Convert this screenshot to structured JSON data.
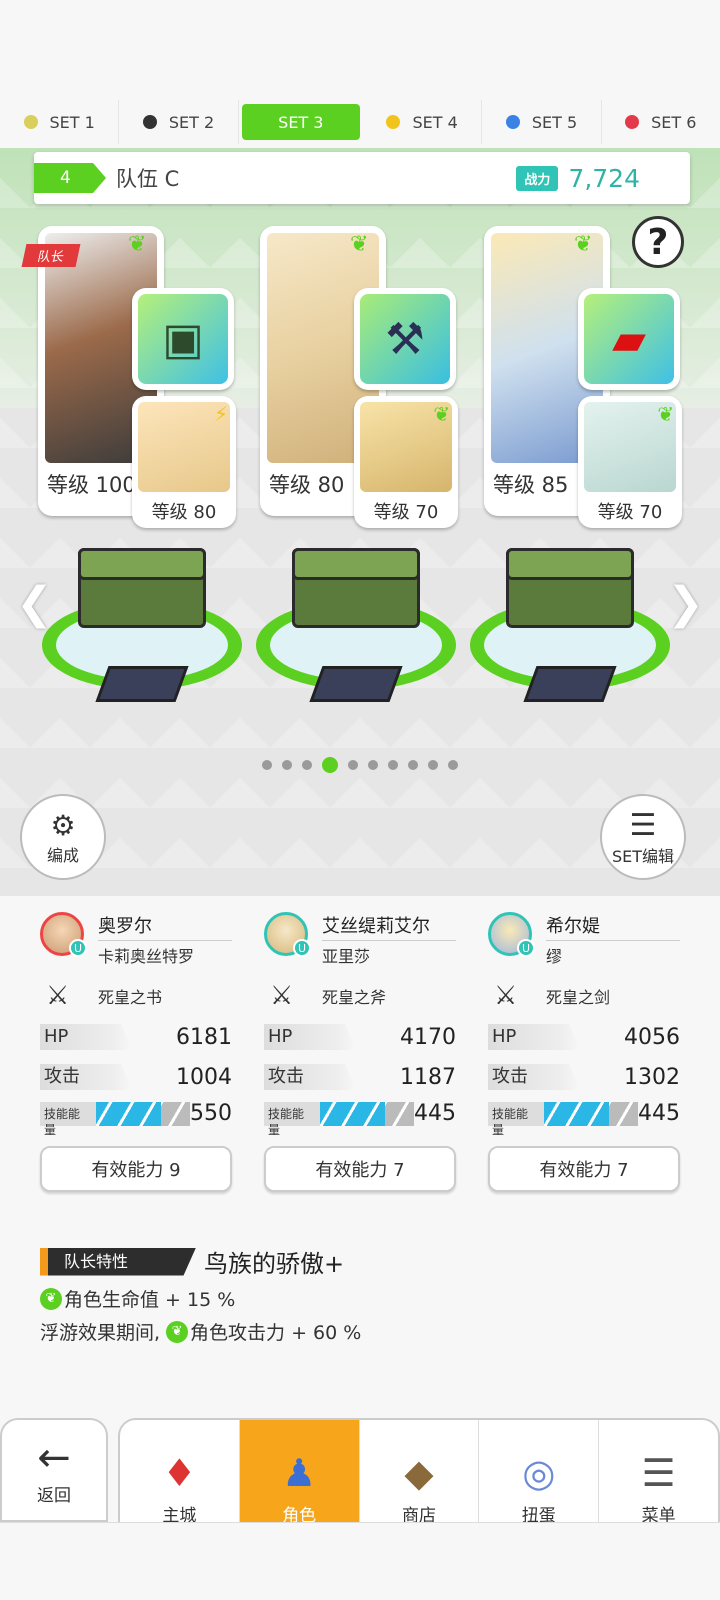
{
  "set_tabs": [
    {
      "label": "SET 1",
      "color": "#d9cf5a"
    },
    {
      "label": "SET 2",
      "color": "#333333"
    },
    {
      "label": "SET 3",
      "color": "#5bd020"
    },
    {
      "label": "SET 4",
      "color": "#f2c41b"
    },
    {
      "label": "SET 5",
      "color": "#3b82e6"
    },
    {
      "label": "SET 6",
      "color": "#e23a4a"
    }
  ],
  "team": {
    "number": "4",
    "name": "队伍 C",
    "power_label": "战力",
    "power_value": "7,724"
  },
  "help": "?",
  "slots": [
    {
      "leader_tag": "队长",
      "main_level": "等级 100",
      "sub_level": "等级 80"
    },
    {
      "main_level": "等级 80",
      "sub_level": "等级 70"
    },
    {
      "main_level": "等级 85",
      "sub_level": "等级 70"
    }
  ],
  "buttons": {
    "formation": "编成",
    "set_edit": "SET编辑"
  },
  "members": [
    {
      "name": "奥罗尔",
      "sub": "卡莉奥丝特罗",
      "weapon": "死皇之书",
      "hp_label": "HP",
      "hp": "6181",
      "atk_label": "攻击",
      "atk": "1004",
      "energy_label": "技能能量",
      "energy": "550",
      "ability": "有效能力 9"
    },
    {
      "name": "艾丝缇莉艾尔",
      "sub": "亚里莎",
      "weapon": "死皇之斧",
      "hp_label": "HP",
      "hp": "4170",
      "atk_label": "攻击",
      "atk": "1187",
      "energy_label": "技能能量",
      "energy": "445",
      "ability": "有效能力 7"
    },
    {
      "name": "希尔媞",
      "sub": "缪",
      "weapon": "死皇之剑",
      "hp_label": "HP",
      "hp": "4056",
      "atk_label": "攻击",
      "atk": "1302",
      "energy_label": "技能能量",
      "energy": "445",
      "ability": "有效能力 7"
    }
  ],
  "leader_skill": {
    "tag": "队长特性",
    "title": "鸟族的骄傲+",
    "line1": "角色生命值 + 15 %",
    "line2_prefix": "浮游效果期间,",
    "line2": "角色攻击力 + 60 %"
  },
  "nav": {
    "back": "返回",
    "items": [
      "主城",
      "角色",
      "商店",
      "扭蛋",
      "菜单"
    ],
    "active": "角色"
  }
}
